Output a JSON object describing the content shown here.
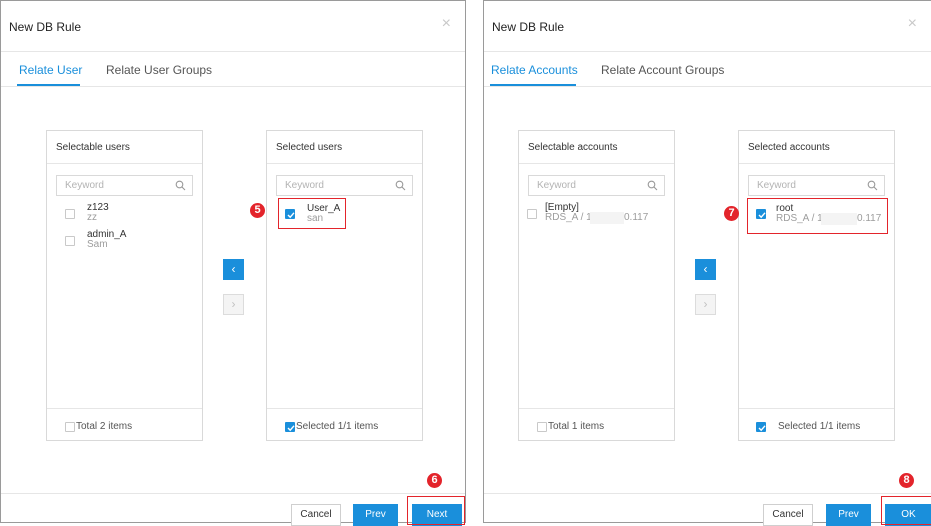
{
  "left_dialog": {
    "title": "New DB Rule",
    "close_glyph": "×",
    "tabs": [
      {
        "label": "Relate User"
      },
      {
        "label": "Relate User Groups"
      }
    ],
    "source_panel": {
      "title": "Selectable users",
      "search_placeholder": "Keyword",
      "items": [
        {
          "name": "z123",
          "sub": "zz"
        },
        {
          "name": "admin_A",
          "sub": "Sam"
        }
      ],
      "footer": "Total 2 items"
    },
    "target_panel": {
      "title": "Selected users",
      "search_placeholder": "Keyword",
      "items": [
        {
          "name": "User_A",
          "sub": "san"
        }
      ],
      "footer": "Selected 1/1 items"
    },
    "move_left_glyph": "‹",
    "move_right_glyph": "›",
    "buttons": {
      "cancel": "Cancel",
      "prev": "Prev",
      "next": "Next"
    },
    "steps": {
      "select": "5",
      "next": "6"
    }
  },
  "right_dialog": {
    "title": "New DB Rule",
    "close_glyph": "×",
    "tabs": [
      {
        "label": "Relate Accounts"
      },
      {
        "label": "Relate Account Groups"
      }
    ],
    "source_panel": {
      "title": "Selectable accounts",
      "search_placeholder": "Keyword",
      "items": [
        {
          "name": "[Empty]",
          "sub_left": "RDS_A / 1",
          "sub_right": "0.117"
        }
      ],
      "footer": "Total 1 items"
    },
    "target_panel": {
      "title": "Selected accounts",
      "search_placeholder": "Keyword",
      "items": [
        {
          "name": "root",
          "sub_left": "RDS_A / 1",
          "sub_right": "0.117"
        }
      ],
      "footer": "Selected 1/1 items"
    },
    "move_left_glyph": "‹",
    "move_right_glyph": "›",
    "buttons": {
      "cancel": "Cancel",
      "prev": "Prev",
      "ok": "OK"
    },
    "steps": {
      "select": "7",
      "ok": "8"
    }
  },
  "colors": {
    "accent": "#1a8fdb",
    "highlight": "#e3242b"
  },
  "icons": [
    "search-icon",
    "checkmark-icon",
    "close-icon",
    "chevron-left-icon",
    "chevron-right-icon"
  ]
}
